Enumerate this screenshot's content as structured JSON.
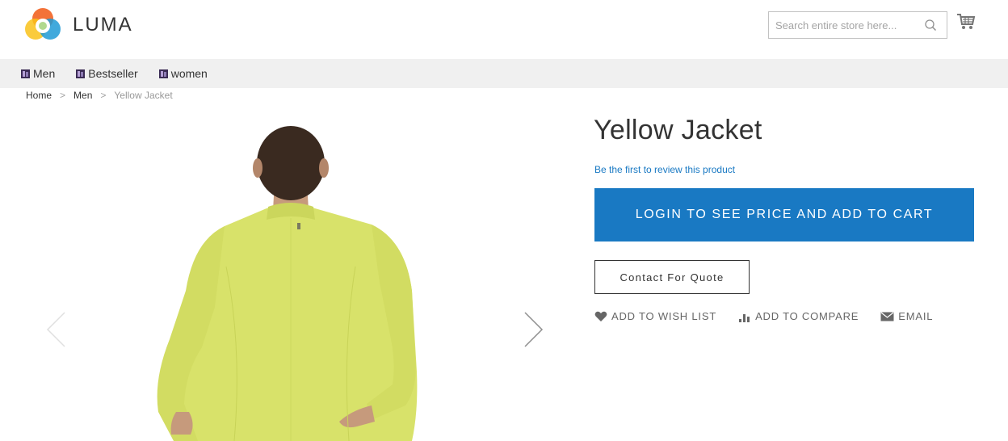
{
  "header": {
    "logo_text": "LUMA",
    "search_placeholder": "Search entire store here..."
  },
  "nav": {
    "items": [
      {
        "label": "Men"
      },
      {
        "label": "Bestseller"
      },
      {
        "label": "women"
      }
    ]
  },
  "breadcrumb": {
    "items": [
      "Home",
      "Men"
    ],
    "separator": ">",
    "current": "Yellow Jacket"
  },
  "product": {
    "title": "Yellow Jacket",
    "review_link": "Be the first to review this product",
    "login_button": "LOGIN TO SEE PRICE AND ADD TO CART",
    "quote_button": "Contact For Quote",
    "actions": {
      "wishlist": "ADD TO WISH LIST",
      "compare": "ADD TO COMPARE",
      "email": "EMAIL"
    }
  },
  "colors": {
    "primary": "#1979c3",
    "nav_bg": "#f0f0f0",
    "jacket": "#d8e26a"
  }
}
